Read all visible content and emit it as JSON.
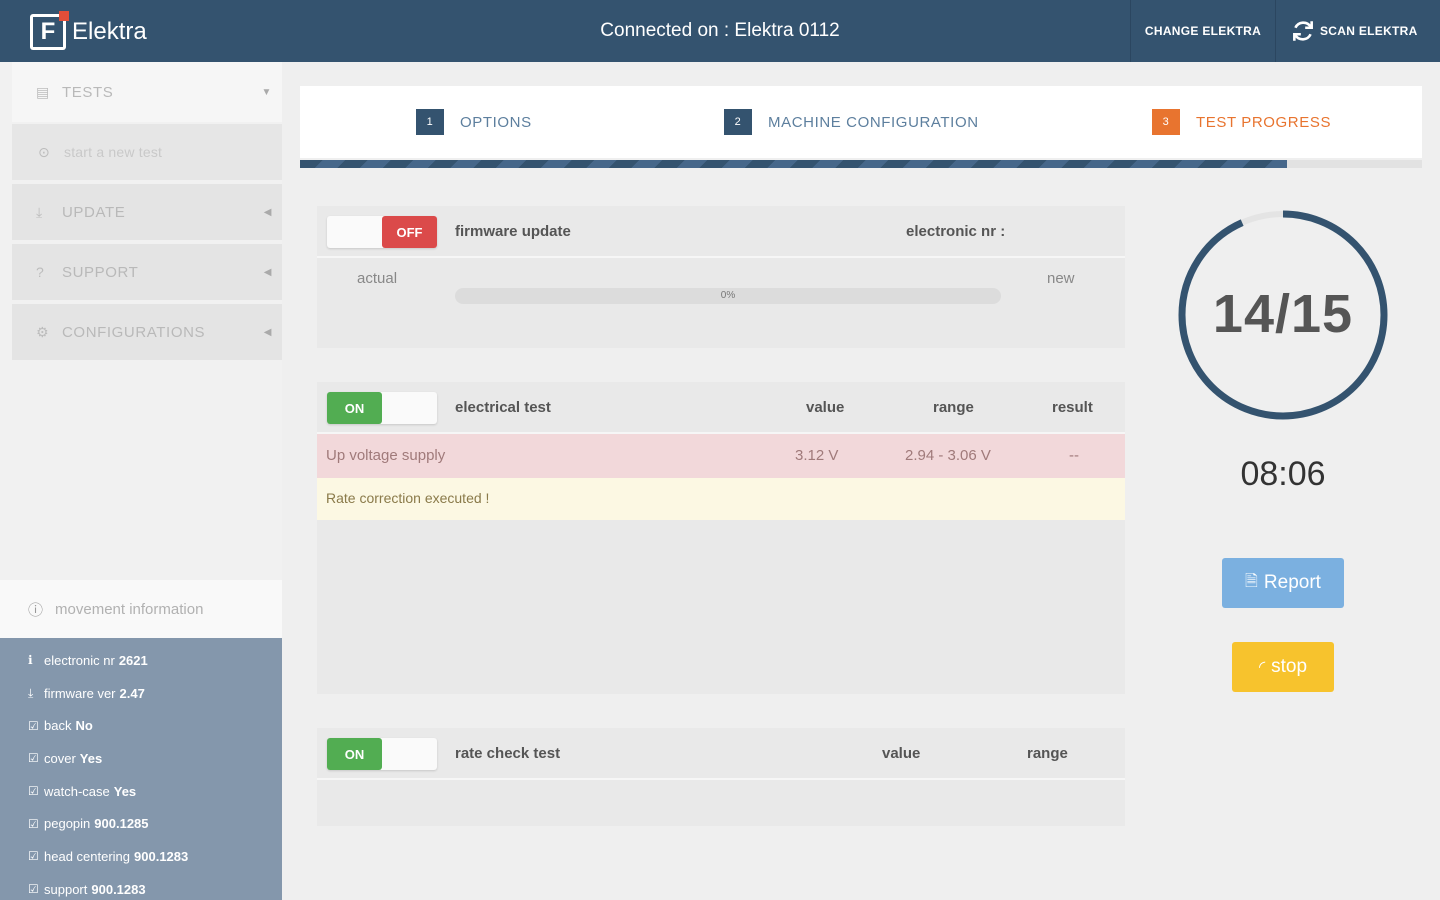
{
  "header": {
    "brand_letter": "F",
    "app_name": "Elektra",
    "connected": "Connected on : Elektra 0112",
    "change_label": "CHANGE ELEKTRA",
    "scan_label": "SCAN ELEKTRA"
  },
  "sidebar": {
    "tests_label": "TESTS",
    "start_label": "start a new test",
    "update_label": "UPDATE",
    "support_label": "SUPPORT",
    "config_label": "CONFIGURATIONS",
    "movement_info_label": "movement information",
    "info": [
      {
        "icon": "info-icon",
        "label": "electronic nr",
        "value": "2621"
      },
      {
        "icon": "download-icon",
        "label": "firmware ver",
        "value": "2.47"
      },
      {
        "icon": "check-icon",
        "label": "back",
        "value": "No"
      },
      {
        "icon": "check-icon",
        "label": "cover",
        "value": "Yes"
      },
      {
        "icon": "check-icon",
        "label": "watch-case",
        "value": "Yes"
      },
      {
        "icon": "check-icon",
        "label": "pegopin",
        "value": "900.1285"
      },
      {
        "icon": "check-icon",
        "label": "head centering",
        "value": "900.1283"
      },
      {
        "icon": "check-icon",
        "label": "support",
        "value": "900.1283"
      }
    ]
  },
  "stepper": {
    "steps": [
      {
        "num": "1",
        "label": "OPTIONS"
      },
      {
        "num": "2",
        "label": "MACHINE CONFIGURATION"
      },
      {
        "num": "3",
        "label": "TEST PROGRESS"
      }
    ],
    "progress_fraction": 0.88
  },
  "firmware": {
    "toggle": "OFF",
    "title": "firmware update",
    "electronic_label": "electronic nr :",
    "actual_label": "actual",
    "new_label": "new",
    "progress_text": "0%",
    "progress_fraction": 0
  },
  "electrical": {
    "toggle": "ON",
    "title": "electrical test",
    "col_value": "value",
    "col_range": "range",
    "col_result": "result",
    "row": {
      "name": "Up voltage supply",
      "value": "3.12 V",
      "range": "2.94 - 3.06 V",
      "result": "--"
    },
    "warning": "Rate correction executed !"
  },
  "rate_check": {
    "toggle": "ON",
    "title": "rate check test",
    "col_value": "value",
    "col_range": "range"
  },
  "progress": {
    "counter": "14/15",
    "completed": 14,
    "total": 15,
    "timer": "08:06",
    "report_label": "Report",
    "stop_label": "stop"
  },
  "colors": {
    "header": "#34536f",
    "accent_orange": "#e8742f",
    "on_green": "#52ad52",
    "off_red": "#db4a4a",
    "report_blue": "#7bb0e0",
    "stop_yellow": "#f7c32d",
    "sidebar_info_bg": "#8497ac"
  }
}
